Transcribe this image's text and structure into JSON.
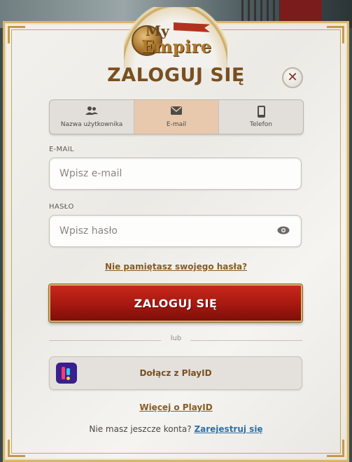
{
  "logo": {
    "line1": "My",
    "line2": "Empire"
  },
  "dialog": {
    "title": "ZALOGUJ SIĘ",
    "close_icon": "close-icon"
  },
  "tabs": [
    {
      "label": "Nazwa użytkownika",
      "icon": "users-icon",
      "active": false
    },
    {
      "label": "E-mail",
      "icon": "envelope-icon",
      "active": true
    },
    {
      "label": "Telefon",
      "icon": "phone-icon",
      "active": false
    }
  ],
  "form": {
    "email_label": "E-MAIL",
    "email_placeholder": "Wpisz e-mail",
    "email_value": "",
    "password_label": "HASŁO",
    "password_placeholder": "Wpisz hasło",
    "password_value": "",
    "forgot_link": "Nie pamiętasz swojego hasła?",
    "login_button": "ZALOGUJ SIĘ",
    "divider_text": "lub",
    "playid_button": "Dołącz z PlayID",
    "playid_more_link": "Więcej o PlayID",
    "no_account_text": "Nie masz jeszcze konta?",
    "register_link": "Zarejestruj się"
  },
  "colors": {
    "accent_brown": "#7a4f1f",
    "button_red": "#a51810",
    "gold_border": "#d8b56c",
    "active_tab": "#e8c9ad",
    "register_link": "#2f6fa5"
  }
}
